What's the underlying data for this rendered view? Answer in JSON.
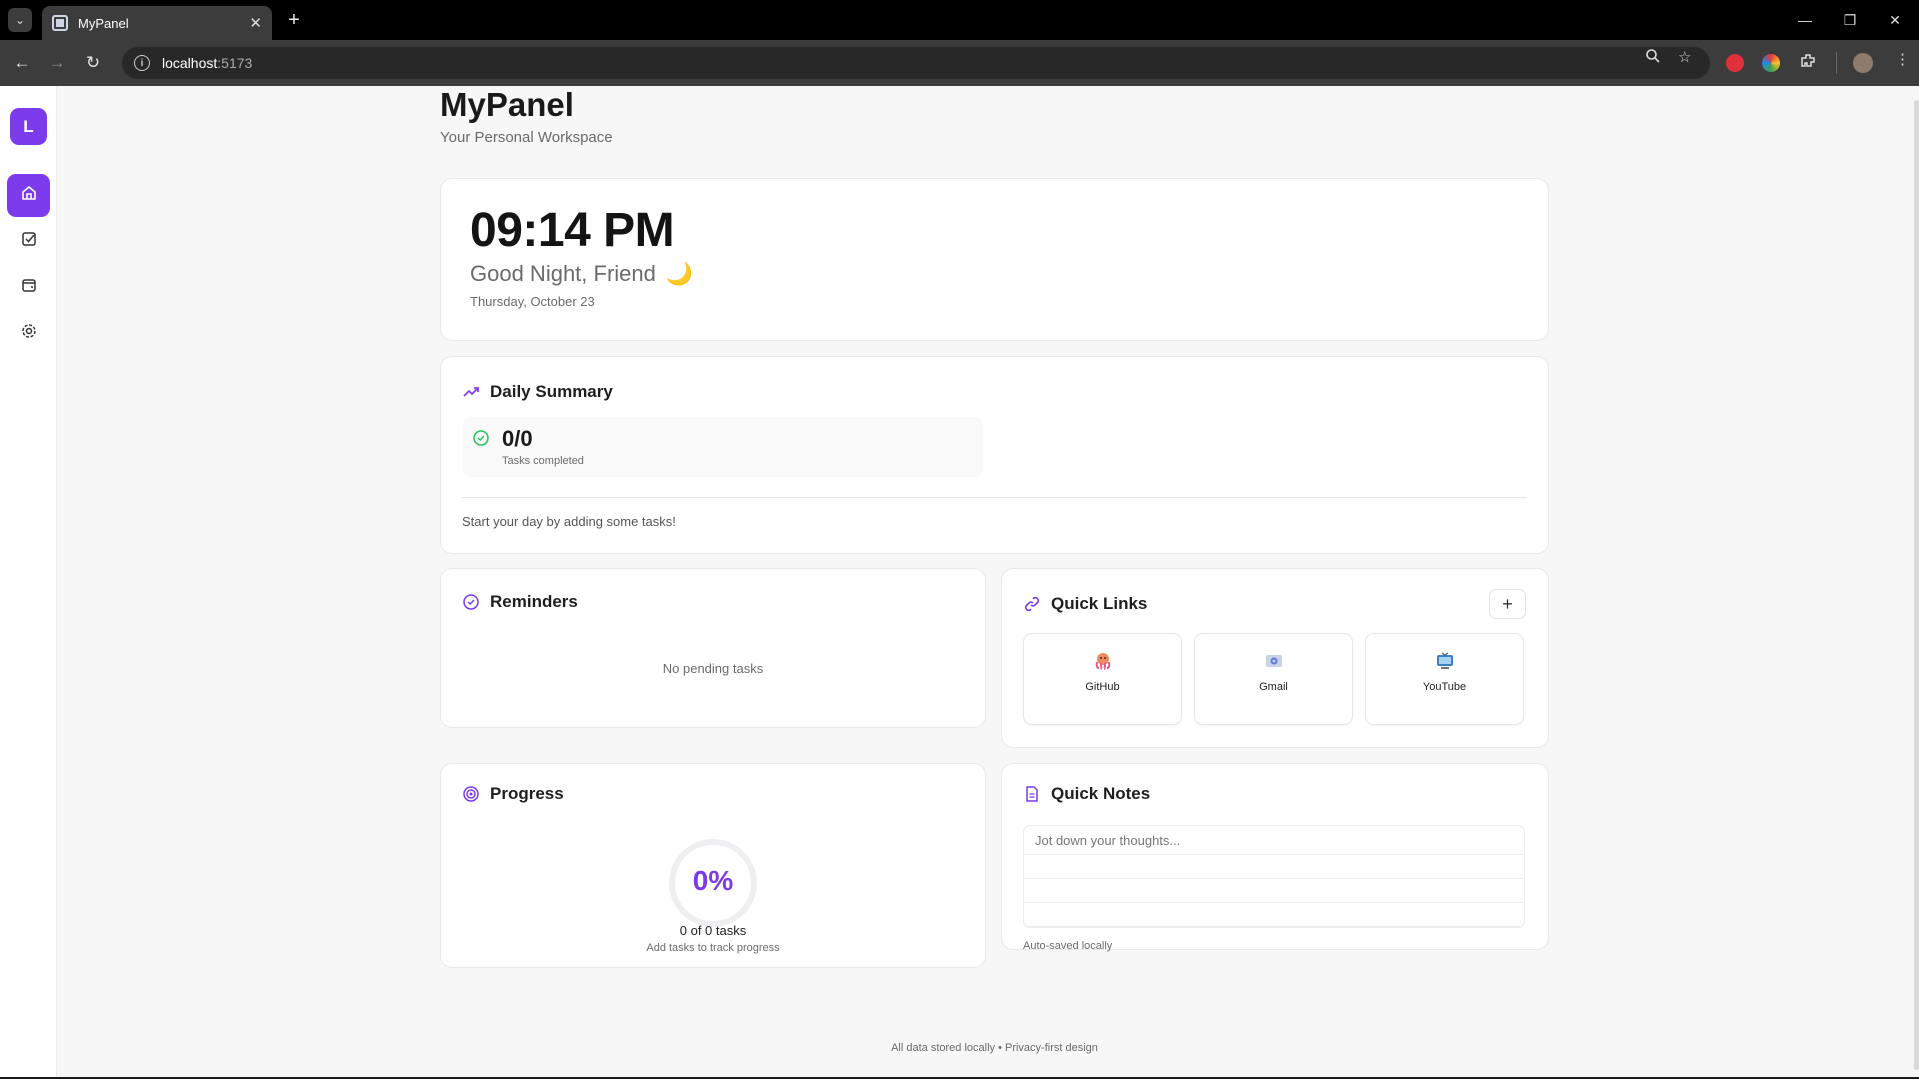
{
  "browser": {
    "tab_title": "MyPanel",
    "url_host": "localhost",
    "url_port": ":5173"
  },
  "sidebar": {
    "avatar_letter": "L",
    "items": [
      {
        "icon": "home-icon",
        "active": true
      },
      {
        "icon": "tasks-icon",
        "active": false
      },
      {
        "icon": "wallet-icon",
        "active": false
      },
      {
        "icon": "settings-icon",
        "active": false
      }
    ]
  },
  "header": {
    "title": "MyPanel",
    "subtitle": "Your Personal Workspace"
  },
  "clock": {
    "time": "09:14 PM",
    "greeting": "Good Night, Friend",
    "greeting_emoji": "🌙",
    "date": "Thursday, October 23"
  },
  "daily_summary": {
    "title": "Daily Summary",
    "tasks_value": "0/0",
    "tasks_label": "Tasks completed",
    "hint": "Start your day by adding some tasks!"
  },
  "reminders": {
    "title": "Reminders",
    "empty_text": "No pending tasks"
  },
  "quick_links": {
    "title": "Quick Links",
    "add_label": "+",
    "links": [
      {
        "name": "GitHub",
        "icon": "octopus-icon"
      },
      {
        "name": "Gmail",
        "icon": "email-icon"
      },
      {
        "name": "YouTube",
        "icon": "tv-icon"
      }
    ]
  },
  "progress": {
    "title": "Progress",
    "percent_label": "0%",
    "percent": 0,
    "tasks_line": "0 of 0 tasks",
    "hint": "Add tasks to track progress"
  },
  "quick_notes": {
    "title": "Quick Notes",
    "placeholder": "Jot down your thoughts...",
    "value": "",
    "autosave_text": "Auto-saved locally"
  },
  "footer": {
    "text": "All data stored locally • Privacy-first design"
  },
  "colors": {
    "accent": "#7c3aed",
    "success": "#22c55e"
  }
}
